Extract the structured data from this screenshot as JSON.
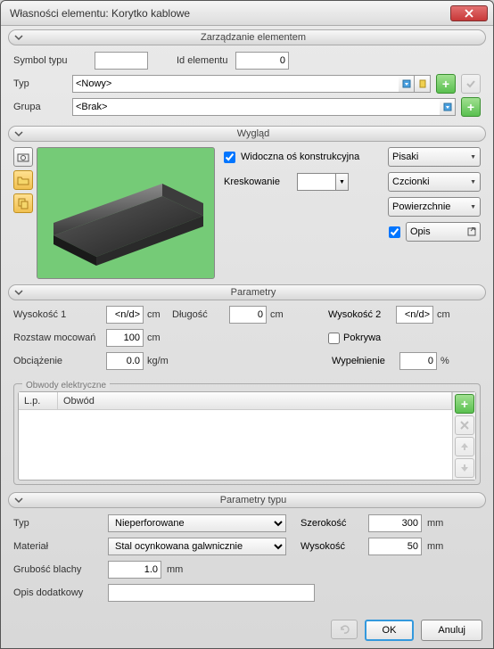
{
  "window": {
    "title": "Własności elementu: Korytko kablowe"
  },
  "sections": {
    "management": {
      "title": "Zarządzanie elementem"
    },
    "appearance": {
      "title": "Wygląd"
    },
    "parameters": {
      "title": "Parametry"
    },
    "circuits": {
      "title": "Obwody elektryczne"
    },
    "type_params": {
      "title": "Parametry typu"
    }
  },
  "management": {
    "symbol_type_label": "Symbol typu",
    "symbol_type_value": "",
    "id_label": "Id elementu",
    "id_value": "0",
    "type_label": "Typ",
    "type_value": "<Nowy>",
    "group_label": "Grupa",
    "group_value": "<Brak>"
  },
  "appearance": {
    "axis_label": "Widoczna oś konstrukcyjna",
    "hatching_label": "Kreskowanie",
    "btn_pens": "Pisaki",
    "btn_fonts": "Czcionki",
    "btn_surfaces": "Powierzchnie",
    "btn_description": "Opis"
  },
  "parameters": {
    "height1_label": "Wysokość 1",
    "height1_value": "<n/d>",
    "height1_unit": "cm",
    "length_label": "Długość",
    "length_value": "0",
    "length_unit": "cm",
    "height2_label": "Wysokość 2",
    "height2_value": "<n/d>",
    "height2_unit": "cm",
    "mount_spacing_label": "Rozstaw mocowań",
    "mount_spacing_value": "100",
    "mount_spacing_unit": "cm",
    "cover_label": "Pokrywa",
    "load_label": "Obciążenie",
    "load_value": "0.0",
    "load_unit": "kg/m",
    "fill_label": "Wypełnienie",
    "fill_value": "0",
    "fill_unit": "%"
  },
  "circuits_table": {
    "col_lp": "L.p.",
    "col_circuit": "Obwód"
  },
  "type_params": {
    "type_label": "Typ",
    "type_value": "Nieperforowane",
    "width_label": "Szerokość",
    "width_value": "300",
    "width_unit": "mm",
    "material_label": "Materiał",
    "material_value": "Stal ocynkowana galwnicznie",
    "height_label": "Wysokość",
    "height_value": "50",
    "height_unit": "mm",
    "thickness_label": "Grubość blachy",
    "thickness_value": "1.0",
    "thickness_unit": "mm",
    "extra_desc_label": "Opis dodatkowy",
    "extra_desc_value": ""
  },
  "footer": {
    "ok": "OK",
    "cancel": "Anuluj"
  }
}
